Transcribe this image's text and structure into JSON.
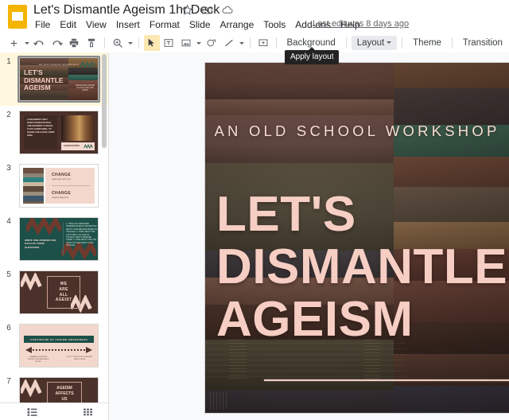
{
  "app": {
    "name": "Google Slides"
  },
  "titlebar": {
    "document_title": "Let's Dismantle Ageism 1hr Deck",
    "icons": [
      {
        "name": "star-icon",
        "label": "Star"
      },
      {
        "name": "move-to-folder-icon",
        "label": "Move"
      },
      {
        "name": "cloud-status-icon",
        "label": "See document status"
      }
    ],
    "last_edit": "Last edit was 8 days ago"
  },
  "menubar": {
    "items": [
      {
        "label": "File"
      },
      {
        "label": "Edit"
      },
      {
        "label": "View"
      },
      {
        "label": "Insert"
      },
      {
        "label": "Format"
      },
      {
        "label": "Slide"
      },
      {
        "label": "Arrange"
      },
      {
        "label": "Tools"
      },
      {
        "label": "Add-ons"
      },
      {
        "label": "Help"
      }
    ]
  },
  "toolbar": {
    "buttons": [
      {
        "name": "new-slide-button",
        "icon": "plus-icon",
        "selected": false
      },
      {
        "name": "new-slide-dropdown",
        "icon": "chevron-down-icon",
        "selected": false
      },
      {
        "name": "undo-button",
        "icon": "undo-icon",
        "selected": false
      },
      {
        "name": "redo-button",
        "icon": "redo-icon",
        "selected": false
      },
      {
        "name": "print-button",
        "icon": "print-icon",
        "selected": false
      },
      {
        "name": "paint-format-button",
        "icon": "paint-format-icon",
        "selected": false
      },
      {
        "name": "zoom-button",
        "icon": "magnifier-icon",
        "selected": false
      },
      {
        "name": "zoom-dropdown",
        "icon": "chevron-down-icon",
        "selected": false
      },
      {
        "name": "select-tool-button",
        "icon": "cursor-arrow-icon",
        "selected": true
      },
      {
        "name": "text-box-button",
        "icon": "text-box-icon",
        "selected": false
      },
      {
        "name": "insert-image-button",
        "icon": "image-icon",
        "selected": false
      },
      {
        "name": "insert-image-dropdown",
        "icon": "chevron-down-icon",
        "selected": false
      },
      {
        "name": "shape-button",
        "icon": "shape-icon",
        "selected": false
      },
      {
        "name": "line-button",
        "icon": "line-icon",
        "selected": false
      },
      {
        "name": "line-dropdown",
        "icon": "chevron-down-icon",
        "selected": false
      },
      {
        "name": "add-comment-button",
        "icon": "add-comment-icon",
        "selected": false
      }
    ],
    "background_label": "Background",
    "layout_label": "Layout",
    "theme_label": "Theme",
    "transition_label": "Transition",
    "tooltip": "Apply layout"
  },
  "filmstrip": {
    "selected_index": 1,
    "slides": [
      {
        "number": "1",
        "kind": "title-books",
        "eyebrow": "AN OLD SCHOOL WORKSHOP",
        "title_lines": [
          "LET'S",
          "DISMANTLE",
          "AGEISM"
        ],
        "caption": "NAVIGATING AGEISM IN OUR LIVES AND WORK"
      },
      {
        "number": "2",
        "kind": "quote-photo",
        "body": "A MOVEMENT ONLY EXISTS WHEN PEOPLE ARE INSPIRED TO MOVE, TO DO SOMETHING, TO SHARE THE CAUSE THEIR OWN",
        "caption": "AGEISM WORKS"
      },
      {
        "number": "3",
        "kind": "change",
        "head1": "CHANGE",
        "sub1": "begins with each of us",
        "head2": "CHANGE",
        "sub2": "requires awareness"
      },
      {
        "number": "4",
        "kind": "questions",
        "head": "WRITE ONE ANSWER FOR EACH OF THESE QUESTIONS.",
        "body": "1. THINK OF A TIME WHEN SOMEONE MADE AN ASSUMPTION ABOUT YOUR ABILITIES BASED ON YOUR AGE. 2. THINK ABOUT THE LAST THING YOU SAID OR THOUGHT ABOUT SOMEONE OLDER. 3. THINK ABOUT THE LAST THING YOU SAID ABOUT YOUR OWN AGE."
      },
      {
        "number": "5",
        "kind": "we-are-all-ageist",
        "lines": [
          "WE",
          "ARE",
          "ALL",
          "AGEIST"
        ]
      },
      {
        "number": "6",
        "kind": "continuum",
        "bar": "CONTINUUM OF AGEISM AWARENESS",
        "left": "UNAWARE OF AGEISM STEREOTYPES AND AGING MYTHS",
        "right": "FULLY CONSCIOUS OF AGEISM IN ALL FORMS"
      },
      {
        "number": "7",
        "kind": "ageism-affects",
        "lines": [
          "AGEISM",
          "AFFECTS",
          "US"
        ]
      }
    ]
  },
  "bottombar": {
    "buttons": [
      {
        "name": "filmstrip-view-button",
        "icon": "filmstrip-icon"
      },
      {
        "name": "grid-view-button",
        "icon": "grid-icon"
      }
    ]
  },
  "canvas": {
    "slide": {
      "eyebrow": "AN OLD SCHOOL WORKSHOP",
      "title_lines": [
        "LET'S",
        "DISMANTLE",
        "AGEISM"
      ],
      "background": "photo-of-stacked-vintage-books"
    }
  },
  "colors": {
    "accent_pink": "#f6cec3",
    "slide_bg_brown": "#5a4038",
    "selection_yellow": "#fce8b2",
    "brand_yellow": "#F4B400",
    "teal": "#1d5048",
    "cream": "#f3d7cd"
  }
}
